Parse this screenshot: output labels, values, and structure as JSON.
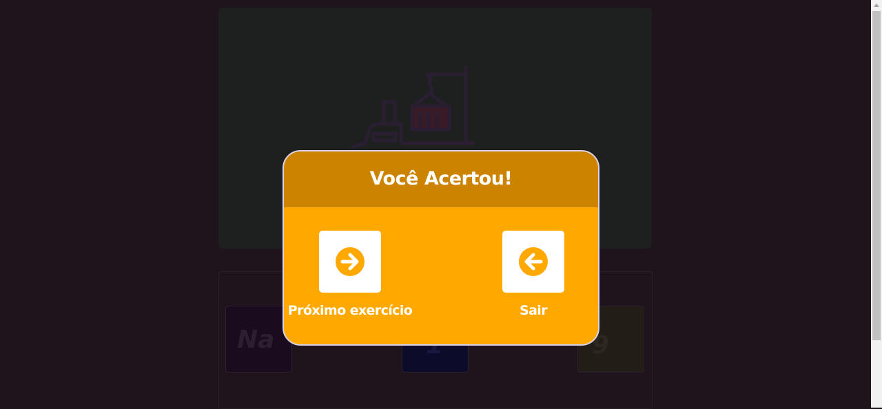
{
  "background": {
    "cards": [
      {
        "symbol": "Na"
      },
      {
        "symbol": "1"
      },
      {
        "symbol": "9"
      }
    ]
  },
  "modal": {
    "title": "Você Acertou!",
    "next_label": "Próximo exercício",
    "next_icon": "arrow-right-circle-icon",
    "exit_label": "Sair",
    "exit_icon": "arrow-left-circle-icon"
  },
  "colors": {
    "modal_body": "#ffa800",
    "modal_header": "#cc8400",
    "overlay_bg": "#1f141c"
  }
}
